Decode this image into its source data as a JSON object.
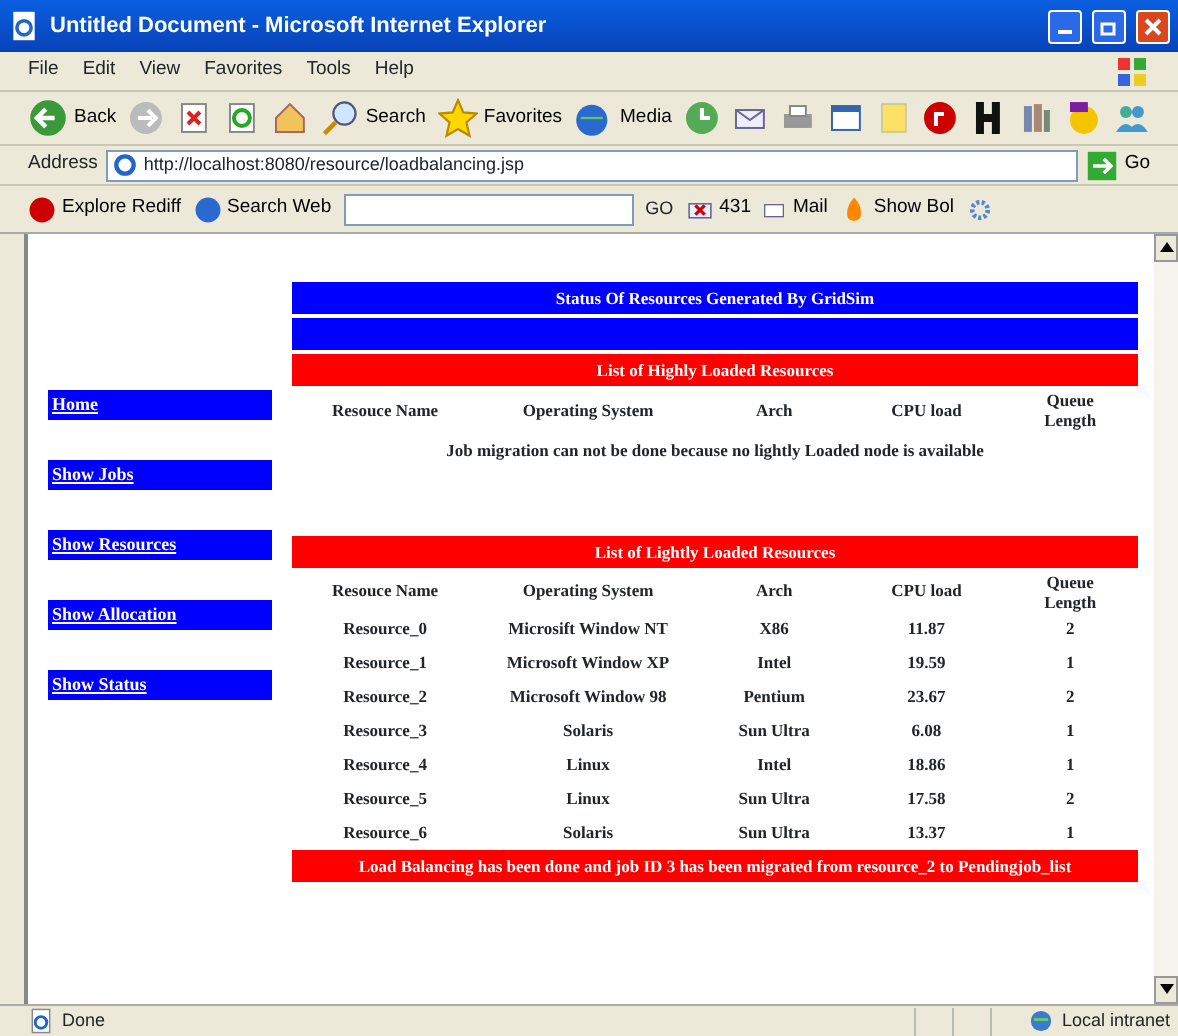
{
  "window": {
    "title": "Untitled Document - Microsoft Internet Explorer"
  },
  "menu": [
    "File",
    "Edit",
    "View",
    "Favorites",
    "Tools",
    "Help"
  ],
  "toolbar": [
    {
      "kind": "back",
      "label": "Back"
    },
    {
      "kind": "forward"
    },
    {
      "kind": "stop"
    },
    {
      "kind": "refresh"
    },
    {
      "kind": "home"
    },
    {
      "kind": "search",
      "label": "Search"
    },
    {
      "kind": "favorites",
      "label": "Favorites"
    },
    {
      "kind": "media",
      "label": "Media"
    },
    {
      "kind": "history"
    },
    {
      "kind": "mail"
    },
    {
      "kind": "print"
    },
    {
      "kind": "edit"
    },
    {
      "kind": "note"
    },
    {
      "kind": "rediff"
    },
    {
      "kind": "h"
    },
    {
      "kind": "book"
    },
    {
      "kind": "yahoo"
    },
    {
      "kind": "messenger"
    }
  ],
  "address": {
    "label": "Address",
    "url": "http://localhost:8080/resource/loadbalancing.jsp",
    "go": "Go"
  },
  "links_bar": {
    "rediff": "Explore Rediff",
    "search_web": "Search Web",
    "go": "GO",
    "count": "431",
    "mail": "Mail",
    "show": "Show Bol"
  },
  "nav": [
    "Home",
    "Show Jobs",
    "Show Resources",
    "Show Allocation",
    "Show Status"
  ],
  "header": "Status Of Resources Generated By GridSim",
  "highly_loaded": {
    "title": "List of Highly Loaded Resources",
    "columns": [
      "Resouce Name",
      "Operating System",
      "Arch",
      "CPU load",
      "Queue Length"
    ],
    "message": "Job migration can not be done because no lightly Loaded node is available"
  },
  "lightly_loaded": {
    "title": "List of Lightly Loaded Resources",
    "columns": [
      "Resouce Name",
      "Operating System",
      "Arch",
      "CPU load",
      "Queue Length"
    ],
    "rows": [
      [
        "Resource_0",
        "Microsift Window NT",
        "X86",
        "11.87",
        "2"
      ],
      [
        "Resource_1",
        "Microsoft Window XP",
        "Intel",
        "19.59",
        "1"
      ],
      [
        "Resource_2",
        "Microsoft Window 98",
        "Pentium",
        "23.67",
        "2"
      ],
      [
        "Resource_3",
        "Solaris",
        "Sun Ultra",
        "6.08",
        "1"
      ],
      [
        "Resource_4",
        "Linux",
        "Intel",
        "18.86",
        "1"
      ],
      [
        "Resource_5",
        "Linux",
        "Sun Ultra",
        "17.58",
        "2"
      ],
      [
        "Resource_6",
        "Solaris",
        "Sun Ultra",
        "13.37",
        "1"
      ]
    ]
  },
  "footer": "Load Balancing has been done and job ID 3 has been migrated from resource_2 to Pendingjob_list",
  "status_bar": {
    "text": "Done",
    "zone": "Local intranet"
  }
}
